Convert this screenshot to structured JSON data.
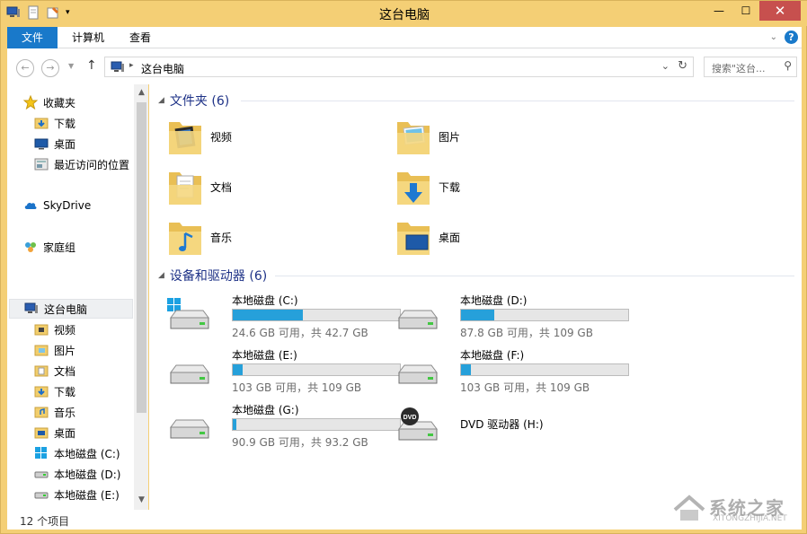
{
  "window": {
    "title": "这台电脑",
    "controls": {
      "minimize": "—",
      "maximize": "☐",
      "close": "✕"
    }
  },
  "ribbon": {
    "tabs": [
      {
        "label": "文件"
      },
      {
        "label": "计算机"
      },
      {
        "label": "查看"
      }
    ]
  },
  "address": {
    "crumb": "这台电脑",
    "search_placeholder": "搜索\"这台..."
  },
  "navpane": {
    "favorites": {
      "label": "收藏夹",
      "items": [
        {
          "label": "下载"
        },
        {
          "label": "桌面"
        },
        {
          "label": "最近访问的位置"
        }
      ]
    },
    "skydrive": "SkyDrive",
    "homegroup": "家庭组",
    "thispc": {
      "label": "这台电脑",
      "items": [
        {
          "label": "视频"
        },
        {
          "label": "图片"
        },
        {
          "label": "文档"
        },
        {
          "label": "下载"
        },
        {
          "label": "音乐"
        },
        {
          "label": "桌面"
        },
        {
          "label": "本地磁盘 (C:)"
        },
        {
          "label": "本地磁盘 (D:)"
        },
        {
          "label": "本地磁盘 (E:)"
        }
      ]
    }
  },
  "content": {
    "folders_header": "文件夹 (6)",
    "folders": [
      {
        "name": "视频",
        "icon": "video-folder-icon"
      },
      {
        "name": "图片",
        "icon": "pictures-folder-icon"
      },
      {
        "name": "文档",
        "icon": "documents-folder-icon"
      },
      {
        "name": "下载",
        "icon": "downloads-folder-icon"
      },
      {
        "name": "音乐",
        "icon": "music-folder-icon"
      },
      {
        "name": "桌面",
        "icon": "desktop-folder-icon"
      }
    ],
    "drives_header": "设备和驱动器 (6)",
    "drives": [
      {
        "name": "本地磁盘 (C:)",
        "info": "24.6 GB 可用，共 42.7 GB",
        "used_fraction": 0.42,
        "icon": "windows-drive-icon"
      },
      {
        "name": "本地磁盘 (D:)",
        "info": "87.8 GB 可用，共 109 GB",
        "used_fraction": 0.2,
        "icon": "hard-drive-icon"
      },
      {
        "name": "本地磁盘 (E:)",
        "info": "103 GB 可用，共 109 GB",
        "used_fraction": 0.06,
        "icon": "hard-drive-icon"
      },
      {
        "name": "本地磁盘 (F:)",
        "info": "103 GB 可用，共 109 GB",
        "used_fraction": 0.06,
        "icon": "hard-drive-icon"
      },
      {
        "name": "本地磁盘 (G:)",
        "info": "90.9 GB 可用，共 93.2 GB",
        "used_fraction": 0.02,
        "icon": "hard-drive-icon"
      },
      {
        "name": "DVD 驱动器 (H:)",
        "icon": "dvd-drive-icon"
      }
    ]
  },
  "status": {
    "count": "12 个项目"
  },
  "watermark": {
    "text": "系统之家",
    "sub": "XITONGZHIJIA.NET"
  },
  "colors": {
    "accent": "#1979ca",
    "title_bg": "#f4cf75",
    "bar_fill": "#26a0da",
    "group_header": "#1e3287"
  }
}
